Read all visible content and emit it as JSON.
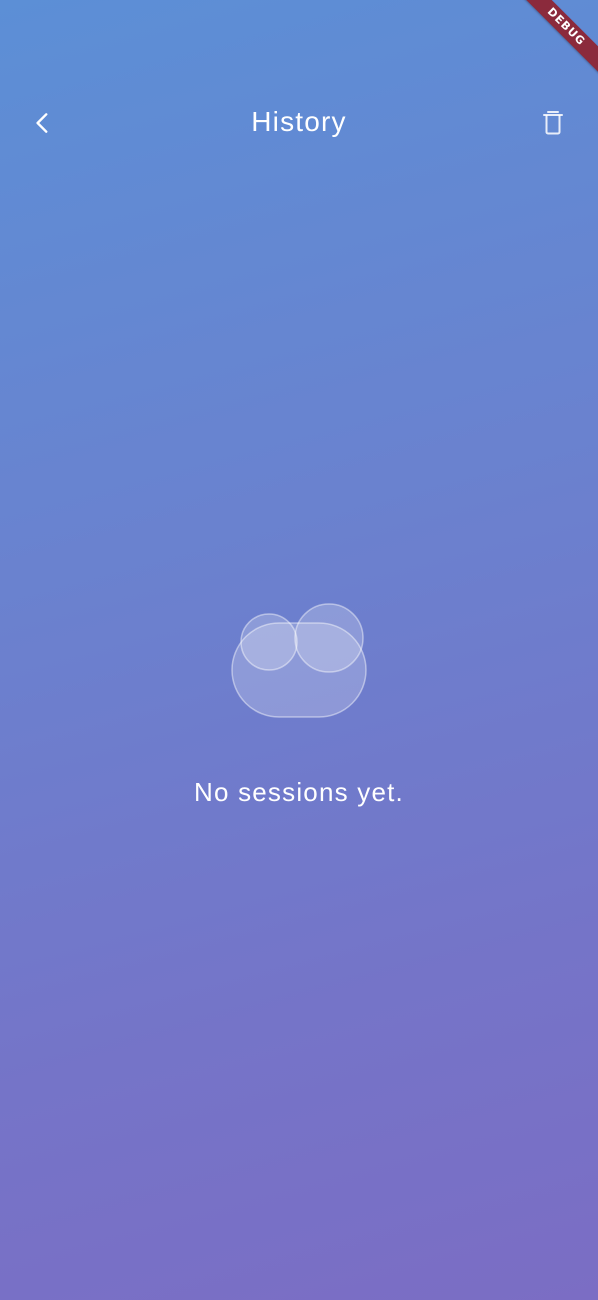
{
  "appbar": {
    "title": "History",
    "back_icon": "chevron-left-icon",
    "trash_icon": "trash-icon"
  },
  "empty_state": {
    "icon": "cloud-icon",
    "message": "No sessions yet."
  },
  "debug_banner": {
    "label": "DEBUG",
    "color": "#8b2a3c"
  },
  "colors": {
    "gradient_top": "#5c8fd6",
    "gradient_bottom": "#7b6dc4",
    "text": "#ffffff"
  }
}
